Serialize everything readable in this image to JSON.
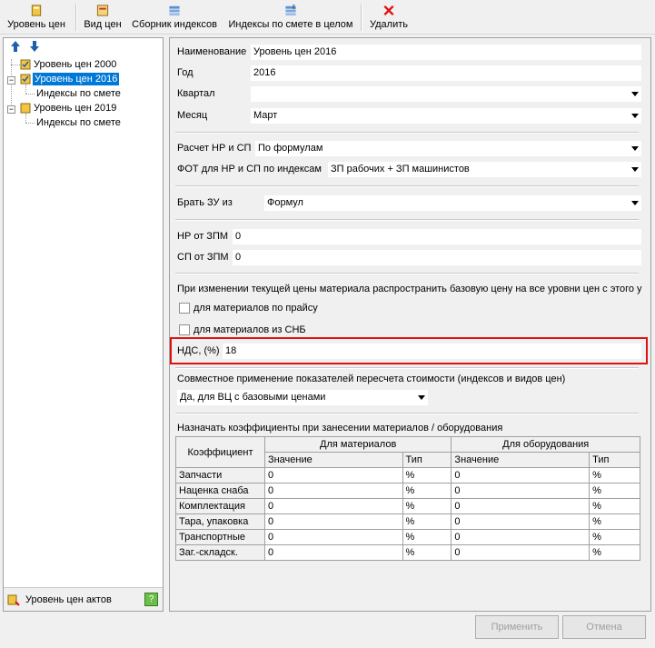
{
  "toolbar": {
    "price_level": "Уровень цен",
    "price_type": "Вид цен",
    "index_collection": "Сборник индексов",
    "estimate_indices": "Индексы по смете в целом",
    "delete": "Удалить",
    "delete_color": "#e01010"
  },
  "tree": {
    "items": [
      {
        "label": "Уровень цен 2000"
      },
      {
        "label": "Уровень цен 2016"
      },
      {
        "label": "Индексы по смете"
      },
      {
        "label": "Уровень цен 2019"
      },
      {
        "label": "Индексы по смете"
      }
    ],
    "selected_color": "#0078d7",
    "footer_label": "Уровень цен актов"
  },
  "form": {
    "name_label": "Наименование",
    "name_value": "Уровень цен 2016",
    "year_label": "Год",
    "year_value": "2016",
    "quarter_label": "Квартал",
    "quarter_value": "",
    "month_label": "Месяц",
    "month_value": "Март",
    "calc_label": "Расчет НР и СП",
    "calc_value": "По формулам",
    "fot_label": "ФОТ для НР и СП по индексам",
    "fot_value": "ЗП рабочих + ЗП машинистов",
    "zu_label": "Брать ЗУ из",
    "zu_value": "Формул",
    "nr_label": "НР от ЗПМ",
    "nr_value": "0",
    "sp_label": "СП от ЗПМ",
    "sp_value": "0",
    "propagate_text": "При изменении текущей цены материала распространить базовую цену на все уровни цен с этого у",
    "cb_price_list": "для материалов по прайсу",
    "cb_snb": "для материалов из СНБ",
    "nds_label": "НДС, (%)",
    "nds_value": "18",
    "highlight_color": "#e01010",
    "joint_label": "Совместное применение показателей пересчета стоимости (индексов и видов цен)",
    "joint_value": "Да, для ВЦ с базовыми ценами",
    "coef_title": "Назначать коэффициенты при занесении материалов / оборудования"
  },
  "coef_table": {
    "col_coef": "Коэффициент",
    "col_materials": "Для материалов",
    "col_equipment": "Для оборудования",
    "col_value": "Значение",
    "col_type": "Тип",
    "rows": [
      {
        "name": "Запчасти",
        "mat_val": "0",
        "mat_type": "%",
        "eq_val": "0",
        "eq_type": "%"
      },
      {
        "name": "Наценка снаба",
        "mat_val": "0",
        "mat_type": "%",
        "eq_val": "0",
        "eq_type": "%"
      },
      {
        "name": "Комплектация",
        "mat_val": "0",
        "mat_type": "%",
        "eq_val": "0",
        "eq_type": "%"
      },
      {
        "name": "Тара, упаковка",
        "mat_val": "0",
        "mat_type": "%",
        "eq_val": "0",
        "eq_type": "%"
      },
      {
        "name": "Транспортные",
        "mat_val": "0",
        "mat_type": "%",
        "eq_val": "0",
        "eq_type": "%"
      },
      {
        "name": "Заг.-складск.",
        "mat_val": "0",
        "mat_type": "%",
        "eq_val": "0",
        "eq_type": "%"
      }
    ]
  },
  "buttons": {
    "apply": "Применить",
    "cancel": "Отмена"
  }
}
